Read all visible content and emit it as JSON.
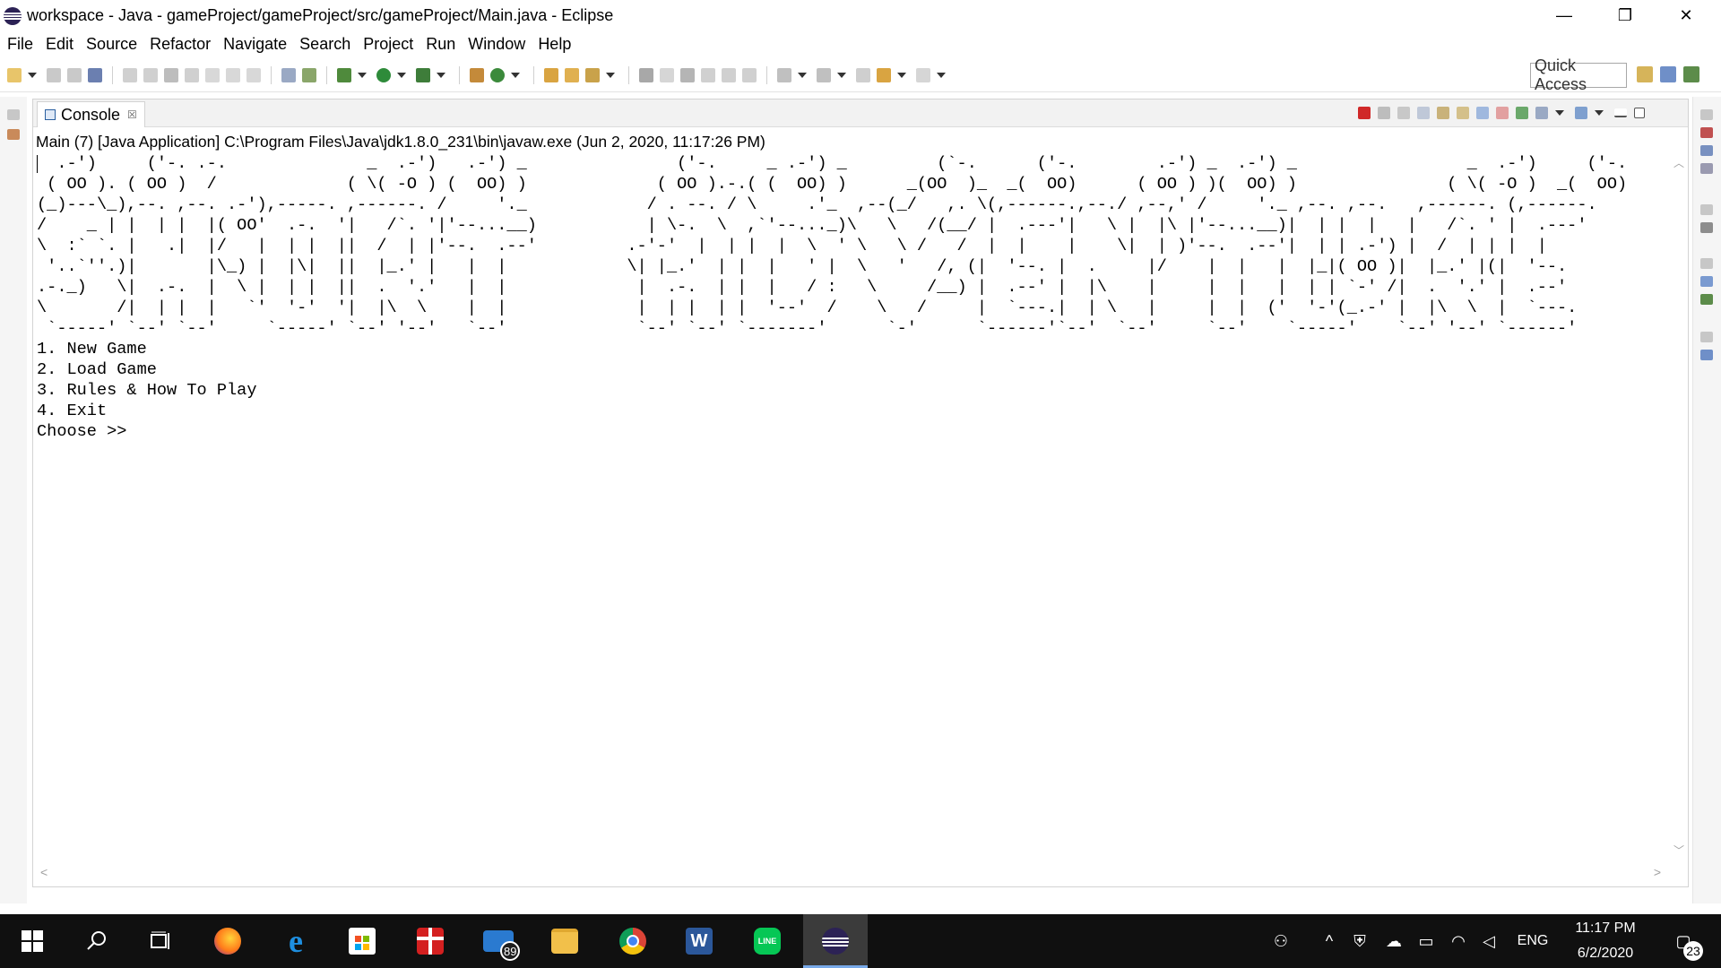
{
  "window": {
    "title": "workspace - Java - gameProject/gameProject/src/gameProject/Main.java - Eclipse",
    "minimize_glyph": "—",
    "maximize_glyph": "❐",
    "close_glyph": "✕"
  },
  "menu": [
    "File",
    "Edit",
    "Source",
    "Refactor",
    "Navigate",
    "Search",
    "Project",
    "Run",
    "Window",
    "Help"
  ],
  "toolbar": {
    "quick_access_label": "Quick Access"
  },
  "console": {
    "tab_label": "Console",
    "tab_close": "☒",
    "process_description": "Main (7) [Java Application] C:\\Program Files\\Java\\jdk1.8.0_231\\bin\\javaw.exe (Jun 2, 2020, 11:17:26 PM)",
    "output": "  .-')     ('-. .-.              _  .-')   .-') _               ('-.     _ .-') _         (`-.      ('-.        .-') _  .-') _                 _  .-')     ('-.\n ( OO ). ( OO )  /             ( \\( -O ) (  OO) )             ( OO ).-.( (  OO) )      _(OO  )_  _(  OO)      ( OO ) )(  OO) )               ( \\( -O )  _(  OO)\n(_)---\\_),--. ,--. .-'),-----. ,------. /     '._            / . --. / \\     .'_  ,--(_/   ,. \\(,------.,--./ ,--,' /     '._ ,--. ,--.   ,------. (,------.\n/    _ | |  | |  |( OO'  .-.  '|   /`. '|'--...__)           | \\-.  \\  ,`'--..._)\\   \\   /(__/ |  .---'|   \\ |  |\\ |'--...__)|  | |  |   |   /`. ' |  .---'\n\\  :` `. |   .|  |/   |  | |  ||  /  | |'--.  .--'         .-'-'  |  | |  |  \\  ' \\   \\ /   /  |  |    |    \\|  | )'--.  .--'|  | | .-') |  /  | | |  |\n '..`''.)|       |\\_) |  |\\|  ||  |_.' |   |  |            \\| |_.'  | |  |   ' |  \\   '   /, (|  '--. |  .     |/    |  |   |  |_|( OO )|  |_.' |(|  '--.\n.-._)   \\|  .-.  |  \\ |  | |  ||  .  '.'   |  |             |  .-.  | |  |   / :   \\     /__) |  .--' |  |\\    |     |  |   |  | | `-' /|  .  '.' |  .--'\n\\       /|  | |  |   `'  '-'  '|  |\\  \\    |  |             |  | |  | |  '--'  /    \\   /     |  `---.|  | \\   |     |  |  ('  '-'(_.-' |  |\\  \\  |  `---.\n `-----' `--' `--'     `-----' `--' '--'   `--'             `--' `--' `-------'      `-'      `------'`--'  `--'     `--'    `-----'    `--' '--' `------'\n1. New Game\n2. Load Game\n3. Rules & How To Play\n4. Exit\nChoose >> "
  },
  "taskbar": {
    "apps": [
      {
        "name": "start",
        "icon": "windows-start-icon"
      },
      {
        "name": "search",
        "icon": "search-icon"
      },
      {
        "name": "task-view",
        "icon": "task-view-icon"
      },
      {
        "name": "firefox",
        "icon": "firefox-icon"
      },
      {
        "name": "edge",
        "icon": "edge-icon",
        "glyph": "e"
      },
      {
        "name": "store",
        "icon": "store-icon"
      },
      {
        "name": "gift",
        "icon": "gift-icon"
      },
      {
        "name": "mail",
        "icon": "mail-icon",
        "badge": "89"
      },
      {
        "name": "file-explorer",
        "icon": "folder-icon"
      },
      {
        "name": "chrome",
        "icon": "chrome-icon"
      },
      {
        "name": "word",
        "icon": "word-icon",
        "glyph": "W"
      },
      {
        "name": "line",
        "icon": "line-icon",
        "glyph": "LINE"
      },
      {
        "name": "eclipse",
        "icon": "eclipse-icon"
      }
    ],
    "language": "ENG",
    "time": "11:17 PM",
    "date": "6/2/2020",
    "notification_count": "23"
  }
}
